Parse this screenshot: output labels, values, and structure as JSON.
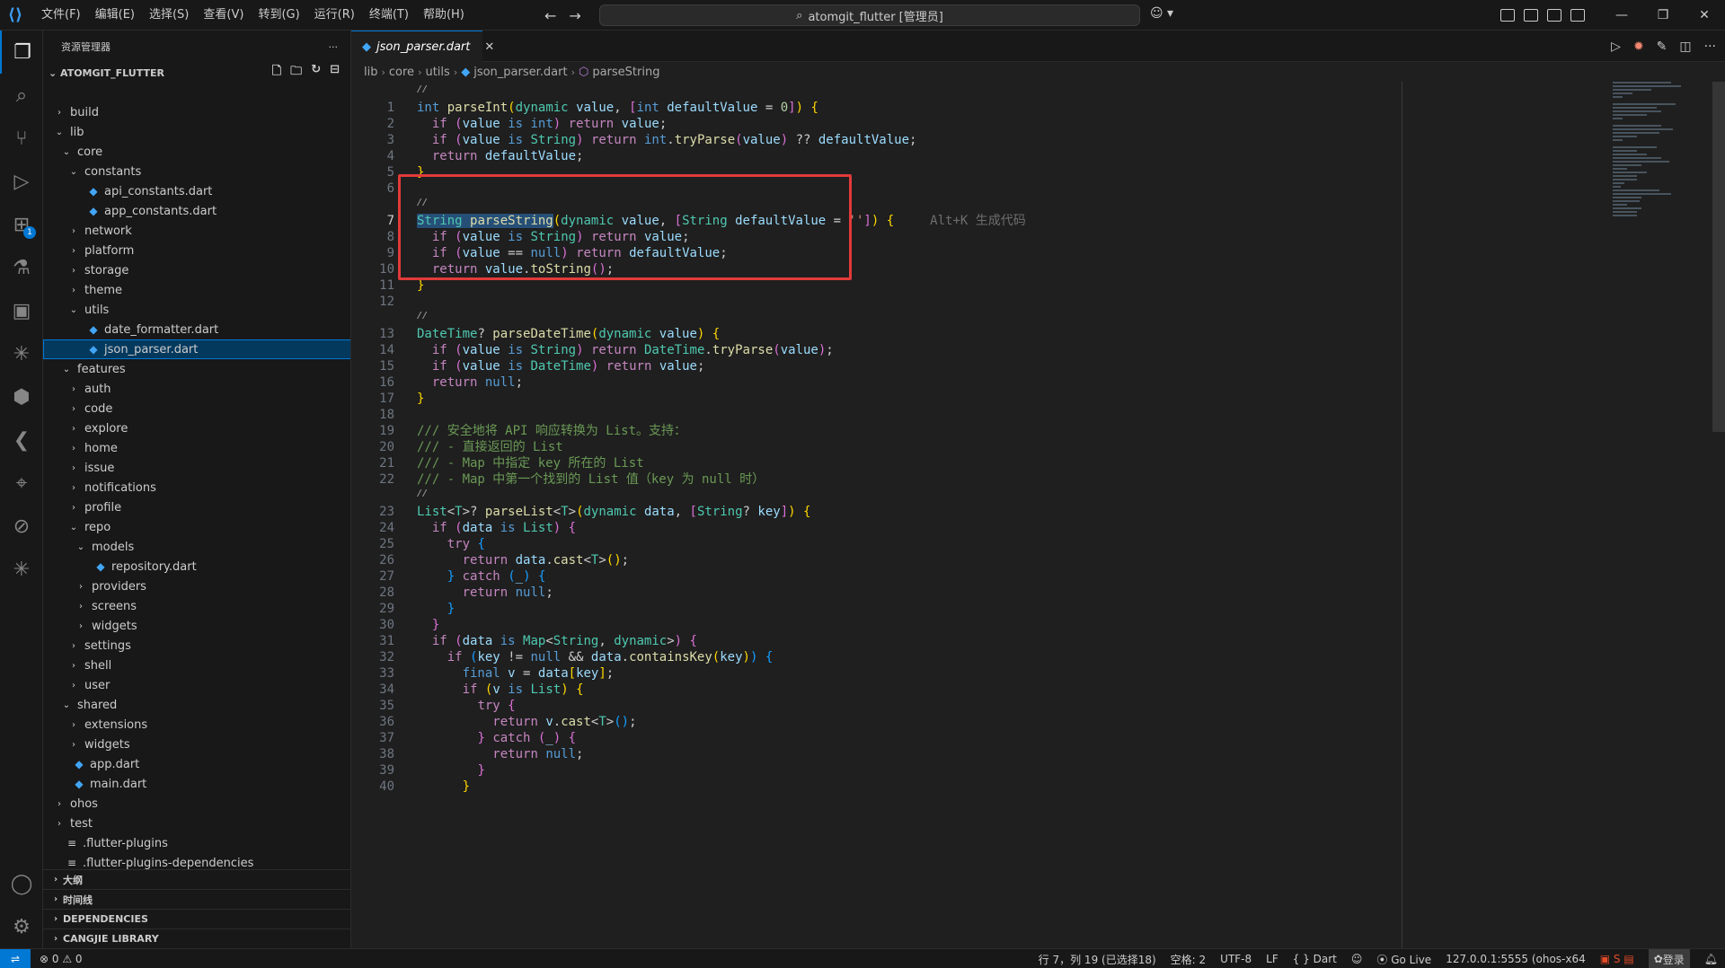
{
  "titlebar": {
    "menus": [
      "文件(F)",
      "编辑(E)",
      "选择(S)",
      "查看(V)",
      "转到(G)",
      "运行(R)",
      "终端(T)",
      "帮助(H)"
    ],
    "search_text": "atomgit_flutter [管理员]"
  },
  "sidebar": {
    "title": "资源管理器",
    "project": "ATOMGIT_FLUTTER",
    "tree": [
      {
        "label": "build",
        "depth": 0,
        "type": "folder",
        "open": false
      },
      {
        "label": "lib",
        "depth": 0,
        "type": "folder",
        "open": true
      },
      {
        "label": "core",
        "depth": 1,
        "type": "folder",
        "open": true
      },
      {
        "label": "constants",
        "depth": 2,
        "type": "folder",
        "open": true
      },
      {
        "label": "api_constants.dart",
        "depth": 3,
        "type": "dart"
      },
      {
        "label": "app_constants.dart",
        "depth": 3,
        "type": "dart"
      },
      {
        "label": "network",
        "depth": 2,
        "type": "folder",
        "open": false
      },
      {
        "label": "platform",
        "depth": 2,
        "type": "folder",
        "open": false
      },
      {
        "label": "storage",
        "depth": 2,
        "type": "folder",
        "open": false
      },
      {
        "label": "theme",
        "depth": 2,
        "type": "folder",
        "open": false
      },
      {
        "label": "utils",
        "depth": 2,
        "type": "folder",
        "open": true
      },
      {
        "label": "date_formatter.dart",
        "depth": 3,
        "type": "dart"
      },
      {
        "label": "json_parser.dart",
        "depth": 3,
        "type": "dart",
        "selected": true
      },
      {
        "label": "features",
        "depth": 1,
        "type": "folder",
        "open": true
      },
      {
        "label": "auth",
        "depth": 2,
        "type": "folder",
        "open": false
      },
      {
        "label": "code",
        "depth": 2,
        "type": "folder",
        "open": false
      },
      {
        "label": "explore",
        "depth": 2,
        "type": "folder",
        "open": false
      },
      {
        "label": "home",
        "depth": 2,
        "type": "folder",
        "open": false
      },
      {
        "label": "issue",
        "depth": 2,
        "type": "folder",
        "open": false
      },
      {
        "label": "notifications",
        "depth": 2,
        "type": "folder",
        "open": false
      },
      {
        "label": "profile",
        "depth": 2,
        "type": "folder",
        "open": false
      },
      {
        "label": "repo",
        "depth": 2,
        "type": "folder",
        "open": true
      },
      {
        "label": "models",
        "depth": 3,
        "type": "folder",
        "open": true
      },
      {
        "label": "repository.dart",
        "depth": 4,
        "type": "dart"
      },
      {
        "label": "providers",
        "depth": 3,
        "type": "folder",
        "open": false
      },
      {
        "label": "screens",
        "depth": 3,
        "type": "folder",
        "open": false
      },
      {
        "label": "widgets",
        "depth": 3,
        "type": "folder",
        "open": false
      },
      {
        "label": "settings",
        "depth": 2,
        "type": "folder",
        "open": false
      },
      {
        "label": "shell",
        "depth": 2,
        "type": "folder",
        "open": false
      },
      {
        "label": "user",
        "depth": 2,
        "type": "folder",
        "open": false
      },
      {
        "label": "shared",
        "depth": 1,
        "type": "folder",
        "open": true
      },
      {
        "label": "extensions",
        "depth": 2,
        "type": "folder",
        "open": false
      },
      {
        "label": "widgets",
        "depth": 2,
        "type": "folder",
        "open": false
      },
      {
        "label": "app.dart",
        "depth": 1,
        "type": "dart"
      },
      {
        "label": "main.dart",
        "depth": 1,
        "type": "dart"
      },
      {
        "label": "ohos",
        "depth": 0,
        "type": "folder",
        "open": false
      },
      {
        "label": "test",
        "depth": 0,
        "type": "folder",
        "open": false
      },
      {
        "label": ".flutter-plugins",
        "depth": 0,
        "type": "file"
      },
      {
        "label": ".flutter-plugins-dependencies",
        "depth": 0,
        "type": "file"
      }
    ],
    "sections": [
      "大纲",
      "时间线",
      "DEPENDENCIES",
      "CANGJIE LIBRARY"
    ]
  },
  "editor": {
    "tab_label": "json_parser.dart",
    "breadcrumb": [
      "lib",
      "core",
      "utils",
      "json_parser.dart",
      "parseString"
    ],
    "inline_hint": "Alt+K 生成代码",
    "active_line": 7
  },
  "statusbar": {
    "errors": "0",
    "warnings": "0",
    "cursor": "行 7，列 19 (已选择18)",
    "spaces": "空格: 2",
    "encoding": "UTF-8",
    "eol": "LF",
    "language": "Dart",
    "golive": "Go Live",
    "server": "127.0.0.1:5555 (ohos-x64",
    "login": "登录"
  }
}
